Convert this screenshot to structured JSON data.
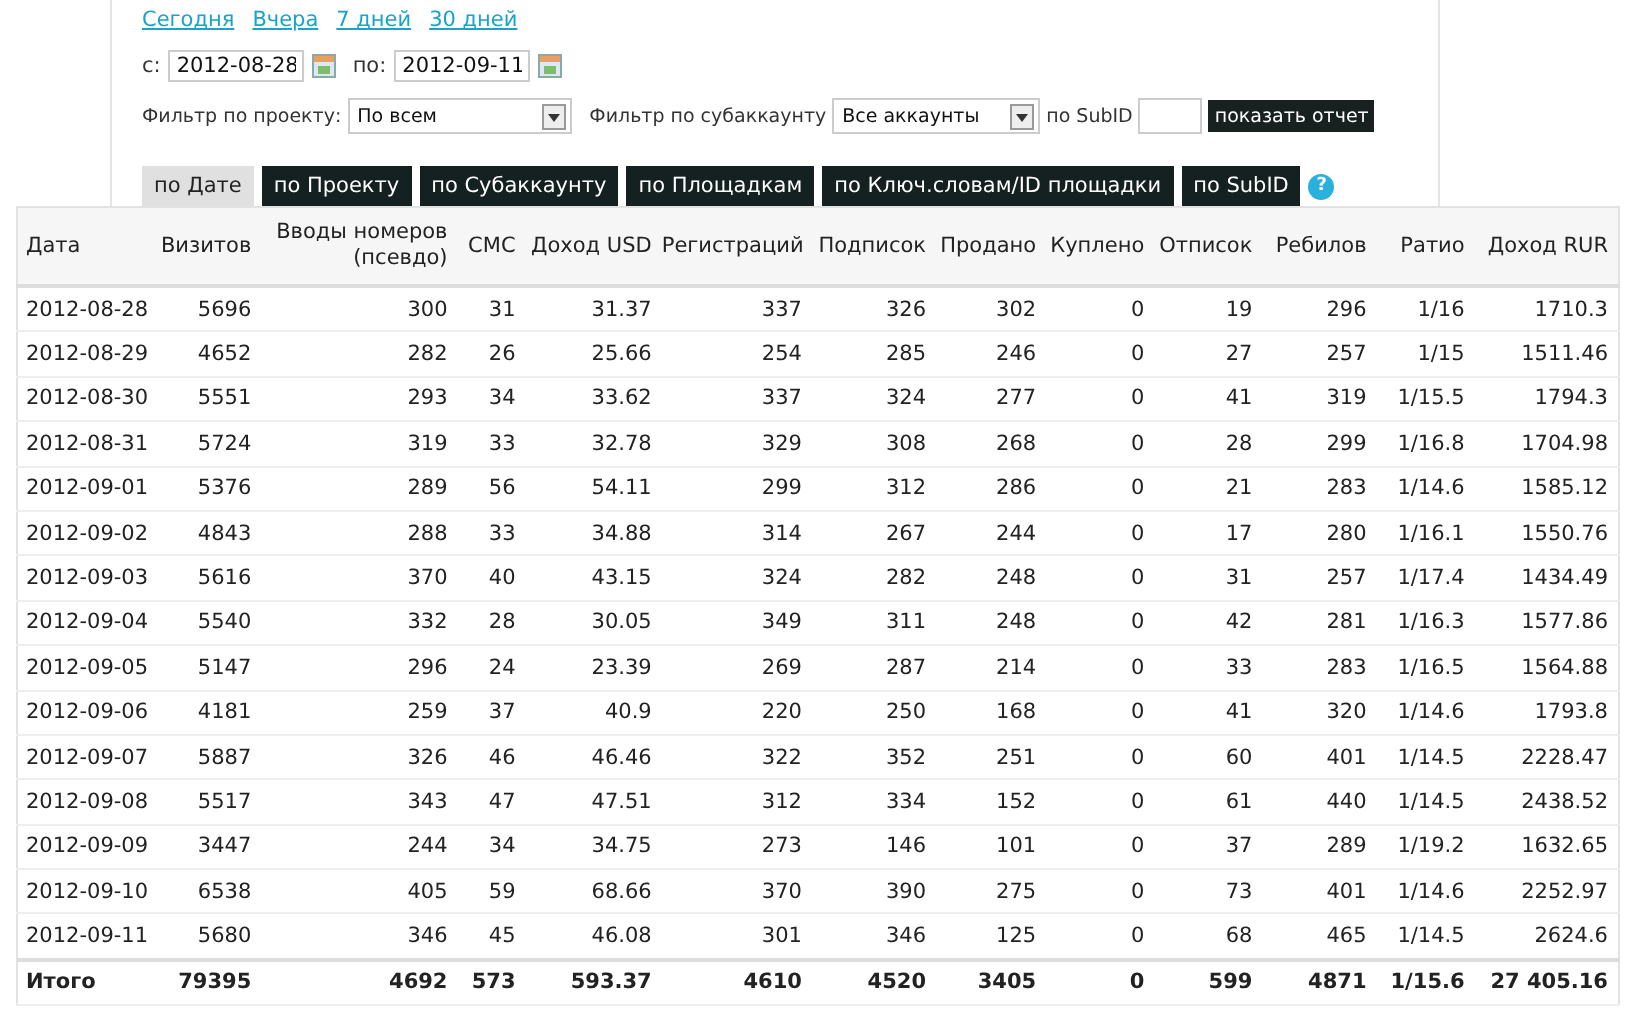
{
  "quick_links": [
    "Сегодня",
    "Вчера",
    "7 дней",
    "30 дней"
  ],
  "date_range": {
    "from_label": "с:",
    "from": "2012-08-28",
    "to_label": "по:",
    "to": "2012-09-11"
  },
  "filters": {
    "project_label": "Фильтр по проекту:",
    "project": "По всем",
    "subaccount_label": "Фильтр по субаккаунту",
    "subaccount": "Все аккаунты",
    "subid_label": "по SubID",
    "submit": "показать отчет"
  },
  "tabs": [
    {
      "label": "по Дате",
      "selected": true
    },
    {
      "label": "по Проекту",
      "selected": false
    },
    {
      "label": "по Субаккаунту",
      "selected": false
    },
    {
      "label": "по Площадкам",
      "selected": false
    },
    {
      "label": "по Ключ.словам/ID площадки",
      "selected": false
    },
    {
      "label": "по SubID",
      "selected": false
    }
  ],
  "help": "?",
  "table": {
    "columns": [
      "Дата",
      "Визитов",
      "Вводы номеров (псевдо)",
      "СМС",
      "Доход USD",
      "Регистраций",
      "Подписок",
      "Продано",
      "Куплено",
      "Отписок",
      "Ребилов",
      "Ратио",
      "Доход RUR"
    ],
    "rows": [
      [
        "2012-08-28",
        "5696",
        "300",
        "31",
        "31.37",
        "337",
        "326",
        "302",
        "0",
        "19",
        "296",
        "1/16",
        "1710.3"
      ],
      [
        "2012-08-29",
        "4652",
        "282",
        "26",
        "25.66",
        "254",
        "285",
        "246",
        "0",
        "27",
        "257",
        "1/15",
        "1511.46"
      ],
      [
        "2012-08-30",
        "5551",
        "293",
        "34",
        "33.62",
        "337",
        "324",
        "277",
        "0",
        "41",
        "319",
        "1/15.5",
        "1794.3"
      ],
      [
        "2012-08-31",
        "5724",
        "319",
        "33",
        "32.78",
        "329",
        "308",
        "268",
        "0",
        "28",
        "299",
        "1/16.8",
        "1704.98"
      ],
      [
        "2012-09-01",
        "5376",
        "289",
        "56",
        "54.11",
        "299",
        "312",
        "286",
        "0",
        "21",
        "283",
        "1/14.6",
        "1585.12"
      ],
      [
        "2012-09-02",
        "4843",
        "288",
        "33",
        "34.88",
        "314",
        "267",
        "244",
        "0",
        "17",
        "280",
        "1/16.1",
        "1550.76"
      ],
      [
        "2012-09-03",
        "5616",
        "370",
        "40",
        "43.15",
        "324",
        "282",
        "248",
        "0",
        "31",
        "257",
        "1/17.4",
        "1434.49"
      ],
      [
        "2012-09-04",
        "5540",
        "332",
        "28",
        "30.05",
        "349",
        "311",
        "248",
        "0",
        "42",
        "281",
        "1/16.3",
        "1577.86"
      ],
      [
        "2012-09-05",
        "5147",
        "296",
        "24",
        "23.39",
        "269",
        "287",
        "214",
        "0",
        "33",
        "283",
        "1/16.5",
        "1564.88"
      ],
      [
        "2012-09-06",
        "4181",
        "259",
        "37",
        "40.9",
        "220",
        "250",
        "168",
        "0",
        "41",
        "320",
        "1/14.6",
        "1793.8"
      ],
      [
        "2012-09-07",
        "5887",
        "326",
        "46",
        "46.46",
        "322",
        "352",
        "251",
        "0",
        "60",
        "401",
        "1/14.5",
        "2228.47"
      ],
      [
        "2012-09-08",
        "5517",
        "343",
        "47",
        "47.51",
        "312",
        "334",
        "152",
        "0",
        "61",
        "440",
        "1/14.5",
        "2438.52"
      ],
      [
        "2012-09-09",
        "3447",
        "244",
        "34",
        "34.75",
        "273",
        "146",
        "101",
        "0",
        "37",
        "289",
        "1/19.2",
        "1632.65"
      ],
      [
        "2012-09-10",
        "6538",
        "405",
        "59",
        "68.66",
        "370",
        "390",
        "275",
        "0",
        "73",
        "401",
        "1/14.6",
        "2252.97"
      ],
      [
        "2012-09-11",
        "5680",
        "346",
        "45",
        "46.08",
        "301",
        "346",
        "125",
        "0",
        "68",
        "465",
        "1/14.5",
        "2624.6"
      ]
    ],
    "total": [
      "Итого",
      "79395",
      "4692",
      "573",
      "593.37",
      "4610",
      "4520",
      "3405",
      "0",
      "599",
      "4871",
      "1/15.6",
      "27 405.16"
    ]
  }
}
